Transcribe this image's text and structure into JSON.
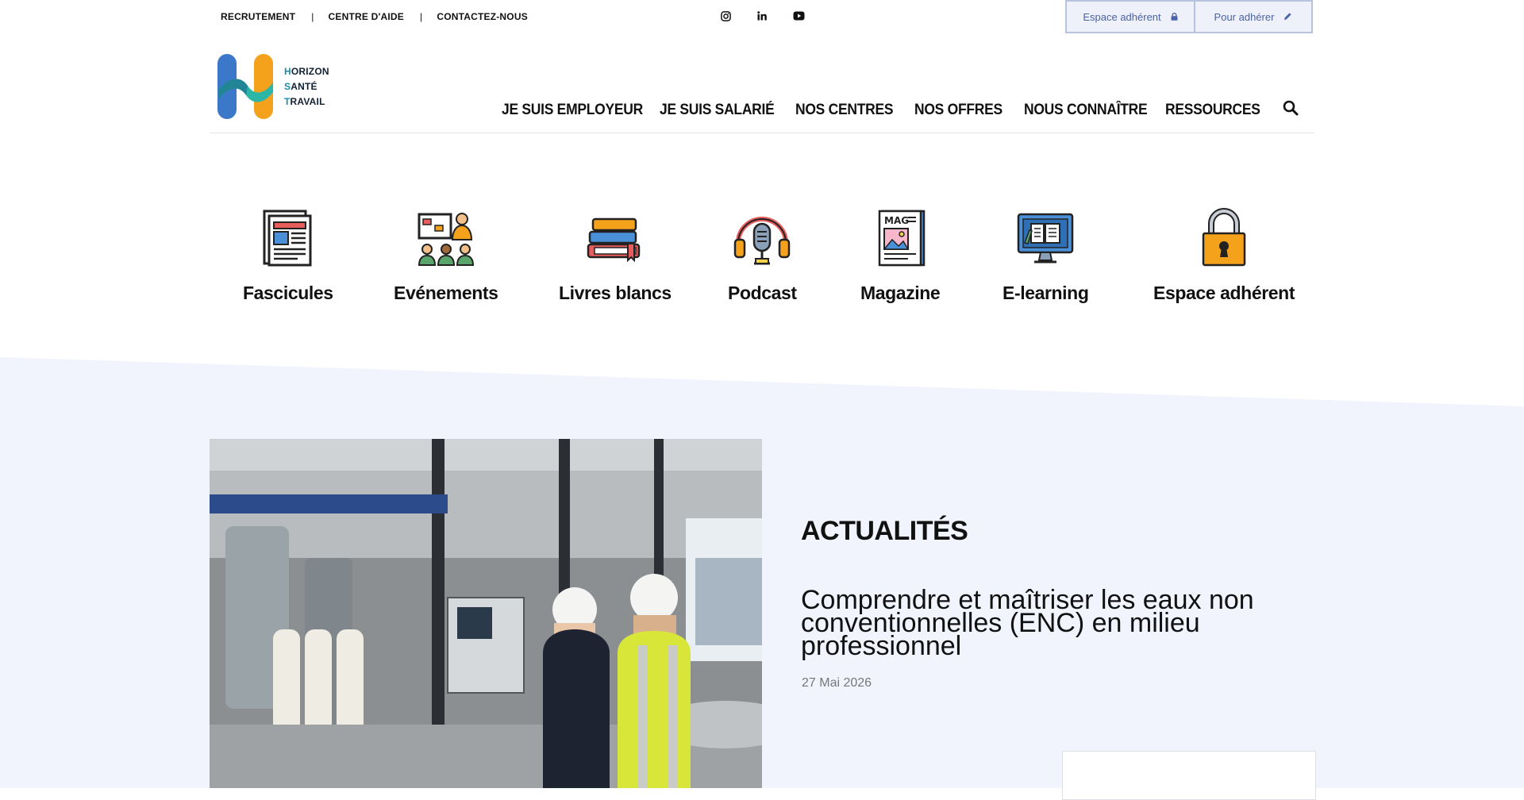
{
  "topbar": {
    "links": [
      "RECRUTEMENT",
      "CENTRE D'AIDE",
      "CONTACTEZ-NOUS"
    ],
    "separator": "|",
    "social_icons": [
      "instagram-icon",
      "linkedin-icon",
      "youtube-icon"
    ],
    "member_button": "Espace adhérent",
    "join_button": "Pour adhérer"
  },
  "logo": {
    "line1_initial": "H",
    "line1_rest": "ORIZON",
    "line2_initial": "S",
    "line2_rest": "ANTÉ",
    "line3_initial": "T",
    "line3_rest": "RAVAIL"
  },
  "nav": {
    "items": [
      "JE SUIS EMPLOYEUR",
      "JE SUIS SALARIÉ",
      "NOS CENTRES",
      "NOS OFFRES",
      "NOUS CONNAÎTRE",
      "RESSOURCES"
    ],
    "search_icon": "search-icon"
  },
  "resources": [
    {
      "label": "Fascicules",
      "icon": "newspaper-icon"
    },
    {
      "label": "Evénements",
      "icon": "presentation-audience-icon"
    },
    {
      "label": "Livres blancs",
      "icon": "books-icon"
    },
    {
      "label": "Podcast",
      "icon": "microphone-headphones-icon"
    },
    {
      "label": "Magazine",
      "icon": "magazine-icon"
    },
    {
      "label": "E-learning",
      "icon": "computer-book-icon"
    },
    {
      "label": "Espace adhérent",
      "icon": "padlock-icon"
    }
  ],
  "news": {
    "section_title": "ACTUALITÉS",
    "headline": "Comprendre et maîtriser les eaux non conventionnelles (ENC) en milieu professionnel",
    "date": "27 Mai 2026"
  },
  "colors": {
    "band": "#f1f4fd",
    "button_bg": "#eef1f9",
    "button_text": "#4b63a7",
    "logo_blue": "#3b78c9",
    "logo_orange": "#f4a11c",
    "logo_teal": "#2bb7a7"
  }
}
